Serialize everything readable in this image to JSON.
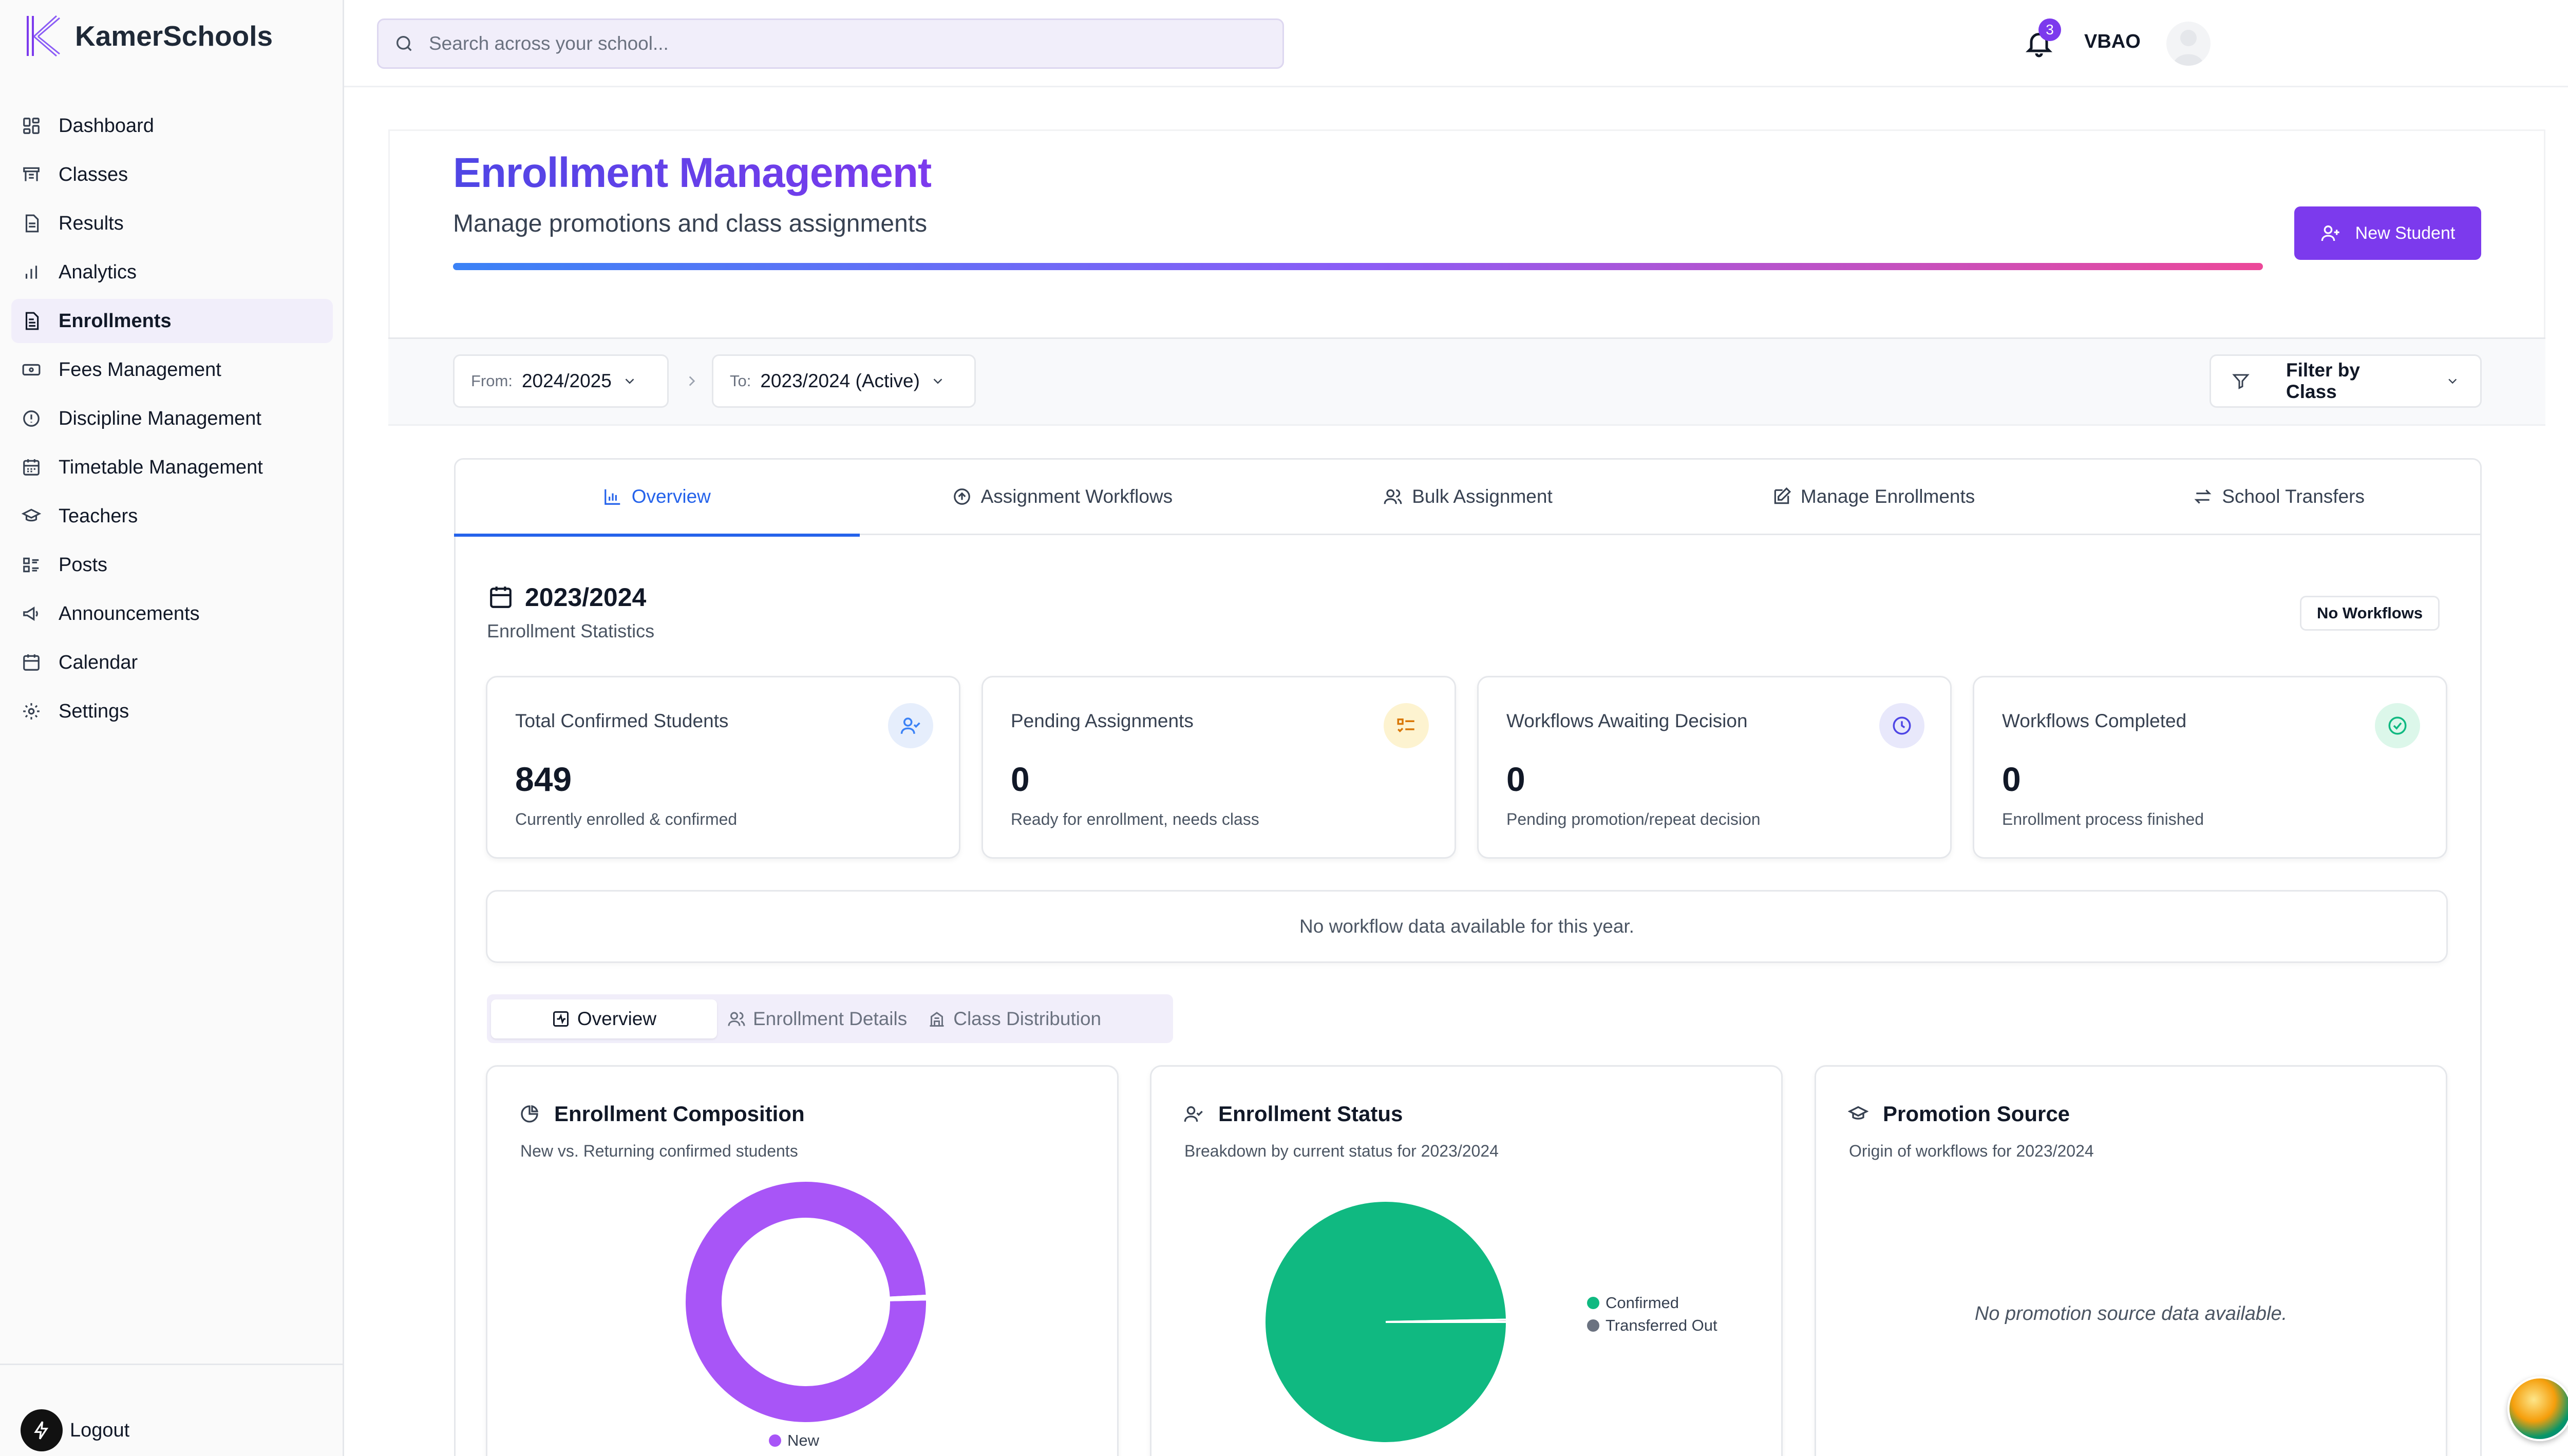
{
  "app": {
    "name": "KamerSchools"
  },
  "sidebar": {
    "items": [
      {
        "label": "Dashboard",
        "icon": "dashboard-icon"
      },
      {
        "label": "Classes",
        "icon": "classes-icon"
      },
      {
        "label": "Results",
        "icon": "results-icon"
      },
      {
        "label": "Analytics",
        "icon": "analytics-icon"
      },
      {
        "label": "Enrollments",
        "icon": "enrollments-icon",
        "active": true
      },
      {
        "label": "Fees Management",
        "icon": "fees-icon"
      },
      {
        "label": "Discipline Management",
        "icon": "discipline-icon"
      },
      {
        "label": "Timetable Management",
        "icon": "timetable-icon"
      },
      {
        "label": "Teachers",
        "icon": "teachers-icon"
      },
      {
        "label": "Posts",
        "icon": "posts-icon"
      },
      {
        "label": "Announcements",
        "icon": "announcements-icon"
      },
      {
        "label": "Calendar",
        "icon": "calendar-icon"
      },
      {
        "label": "Settings",
        "icon": "settings-icon"
      }
    ],
    "logout_label": "Logout"
  },
  "topbar": {
    "search_placeholder": "Search across your school...",
    "notification_count": "3",
    "user_name": "VBAO"
  },
  "header": {
    "title": "Enrollment Management",
    "subtitle": "Manage promotions and class assignments",
    "new_student_label": "New Student"
  },
  "filters": {
    "from_label": "From:",
    "from_value": "2024/2025",
    "to_label": "To:",
    "to_value": "2023/2024 (Active)",
    "class_filter_label": "Filter by Class"
  },
  "tabs": [
    {
      "label": "Overview",
      "active": true
    },
    {
      "label": "Assignment Workflows"
    },
    {
      "label": "Bulk Assignment"
    },
    {
      "label": "Manage Enrollments"
    },
    {
      "label": "School Transfers"
    }
  ],
  "overview": {
    "year": "2023/2024",
    "year_subtitle": "Enrollment Statistics",
    "workflow_badge": "No Workflows",
    "stats": [
      {
        "label": "Total Confirmed Students",
        "value": "849",
        "desc": "Currently enrolled & confirmed",
        "icon": "user-check-icon",
        "color": "#3b82f6",
        "bg": "#e6eefc"
      },
      {
        "label": "Pending Assignments",
        "value": "0",
        "desc": "Ready for enrollment, needs class",
        "icon": "list-todo-icon",
        "color": "#d97706",
        "bg": "#fdf3d0"
      },
      {
        "label": "Workflows Awaiting Decision",
        "value": "0",
        "desc": "Pending promotion/repeat decision",
        "icon": "clock-icon",
        "color": "#4f46e5",
        "bg": "#e8e8fb"
      },
      {
        "label": "Workflows Completed",
        "value": "0",
        "desc": "Enrollment process finished",
        "icon": "check-circle-icon",
        "color": "#10b981",
        "bg": "#dcf7ea"
      }
    ],
    "no_workflow_text": "No workflow data available for this year.",
    "subtabs": [
      {
        "label": "Overview",
        "active": true
      },
      {
        "label": "Enrollment Details"
      },
      {
        "label": "Class Distribution"
      }
    ]
  },
  "charts": {
    "composition": {
      "title": "Enrollment Composition",
      "subtitle": "New vs. Returning confirmed students",
      "legend_new": "New"
    },
    "status": {
      "title": "Enrollment Status",
      "subtitle": "Breakdown by current status for 2023/2024",
      "legend_confirmed": "Confirmed",
      "legend_transferred": "Transferred Out"
    },
    "promotion": {
      "title": "Promotion Source",
      "subtitle": "Origin of workflows for 2023/2024",
      "empty_text": "No promotion source data available."
    }
  },
  "chart_data": [
    {
      "type": "pie",
      "variant": "donut",
      "categories": [
        "New",
        "Returning"
      ],
      "values": [
        99.5,
        0.5
      ],
      "colors": [
        "#a855f7",
        "#ffffff"
      ]
    },
    {
      "type": "pie",
      "categories": [
        "Confirmed",
        "Transferred Out"
      ],
      "values": [
        99.7,
        0.3
      ],
      "colors": [
        "#10b981",
        "#6b7280"
      ]
    }
  ]
}
